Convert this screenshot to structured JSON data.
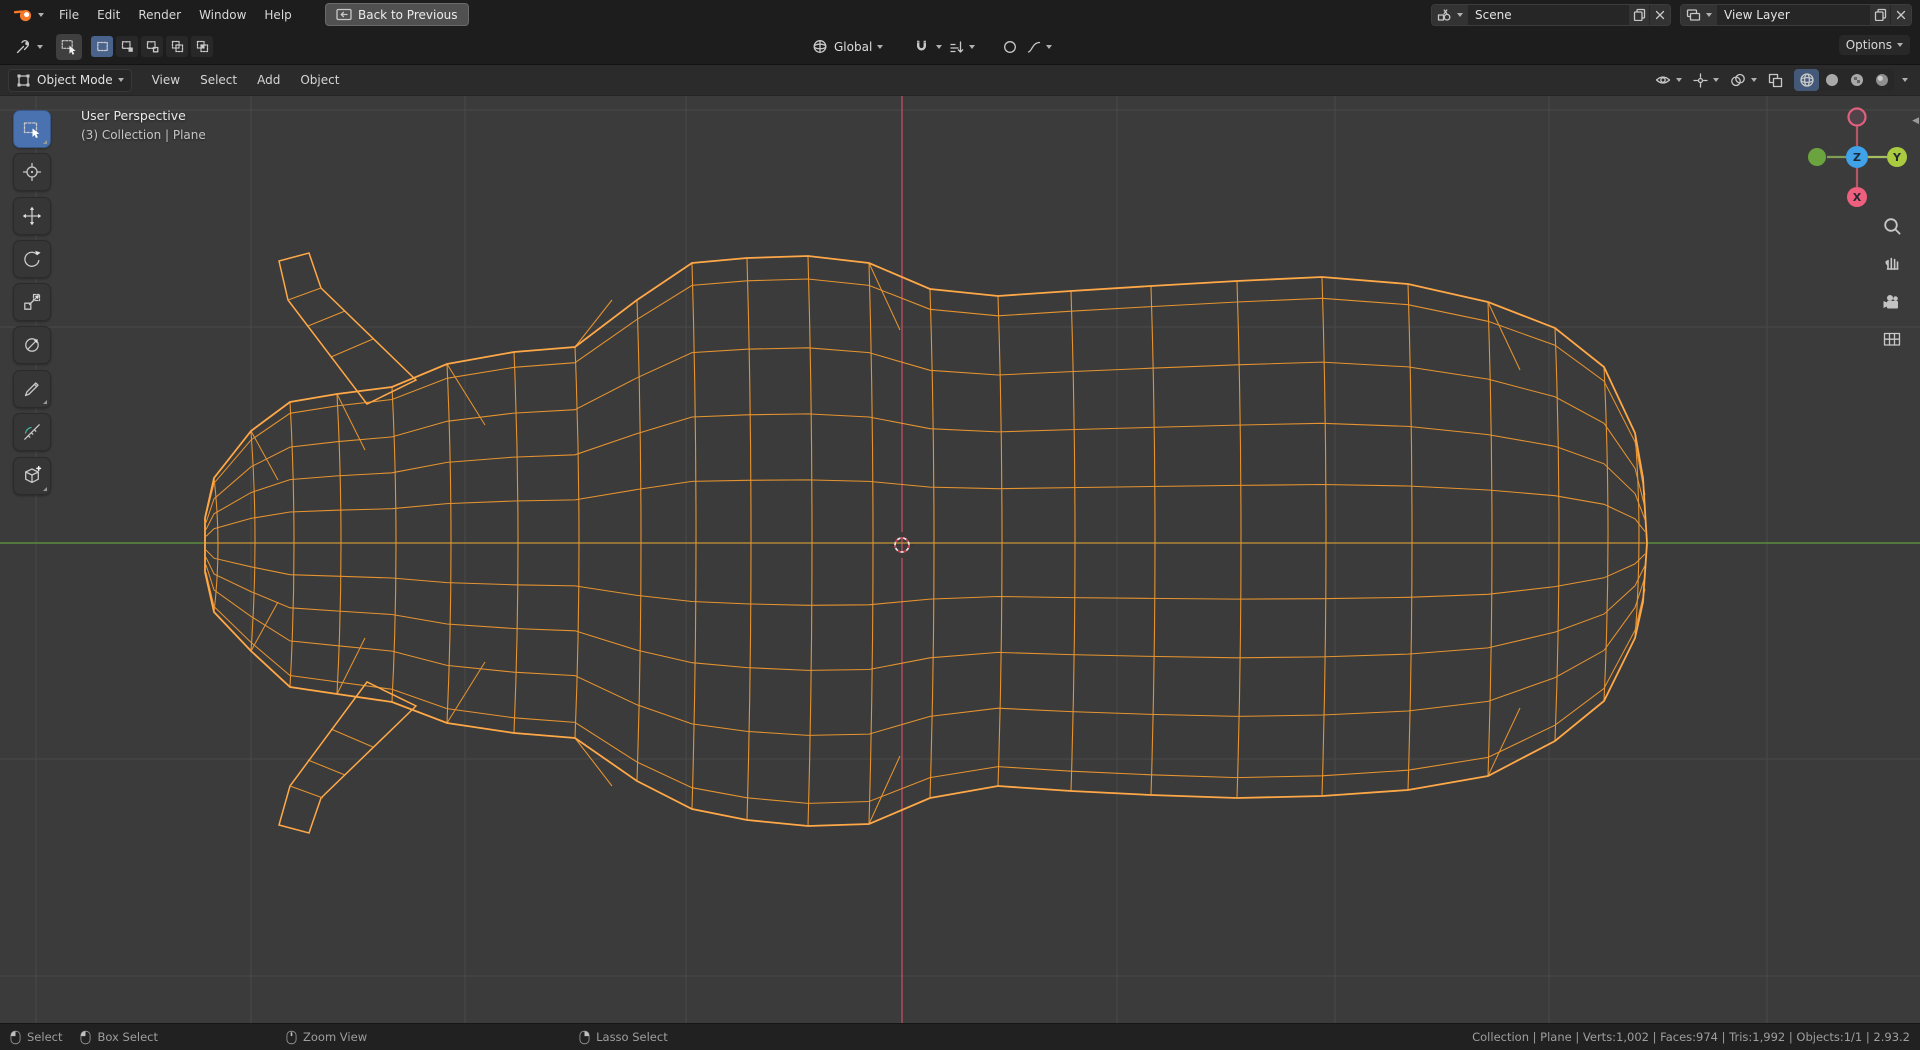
{
  "topbar": {
    "menus": [
      {
        "label": "File"
      },
      {
        "label": "Edit"
      },
      {
        "label": "Render"
      },
      {
        "label": "Window"
      },
      {
        "label": "Help"
      }
    ],
    "back_label": "Back to Previous",
    "scene_value": "Scene",
    "view_layer_value": "View Layer"
  },
  "tool_settings": {
    "orientation_value": "Global",
    "options_label": "Options"
  },
  "viewport_header": {
    "mode_value": "Object Mode",
    "menus": [
      {
        "label": "View"
      },
      {
        "label": "Select"
      },
      {
        "label": "Add"
      },
      {
        "label": "Object"
      }
    ]
  },
  "viewport": {
    "perspective_label": "User Perspective",
    "context_label": "(3) Collection | Plane",
    "gizmo_labels": {
      "x": "X",
      "y": "Y",
      "z": "Z"
    }
  },
  "statusbar": {
    "hints": [
      {
        "label": "Select"
      },
      {
        "label": "Box Select"
      },
      {
        "label": "Zoom View"
      },
      {
        "label": "Lasso Select"
      }
    ],
    "stats": "Collection | Plane | Verts:1,002 | Faces:974 | Tris:1,992 | Objects:1/1 | 2.93.2"
  },
  "colors": {
    "accent": "#4a72b0",
    "wire": "#e59330",
    "wire_bright": "#ffa847",
    "axis_x": "#c24d60",
    "axis_y": "#5f9d3f",
    "grid": "#484848",
    "viewport_bg": "#3b3b3b"
  }
}
